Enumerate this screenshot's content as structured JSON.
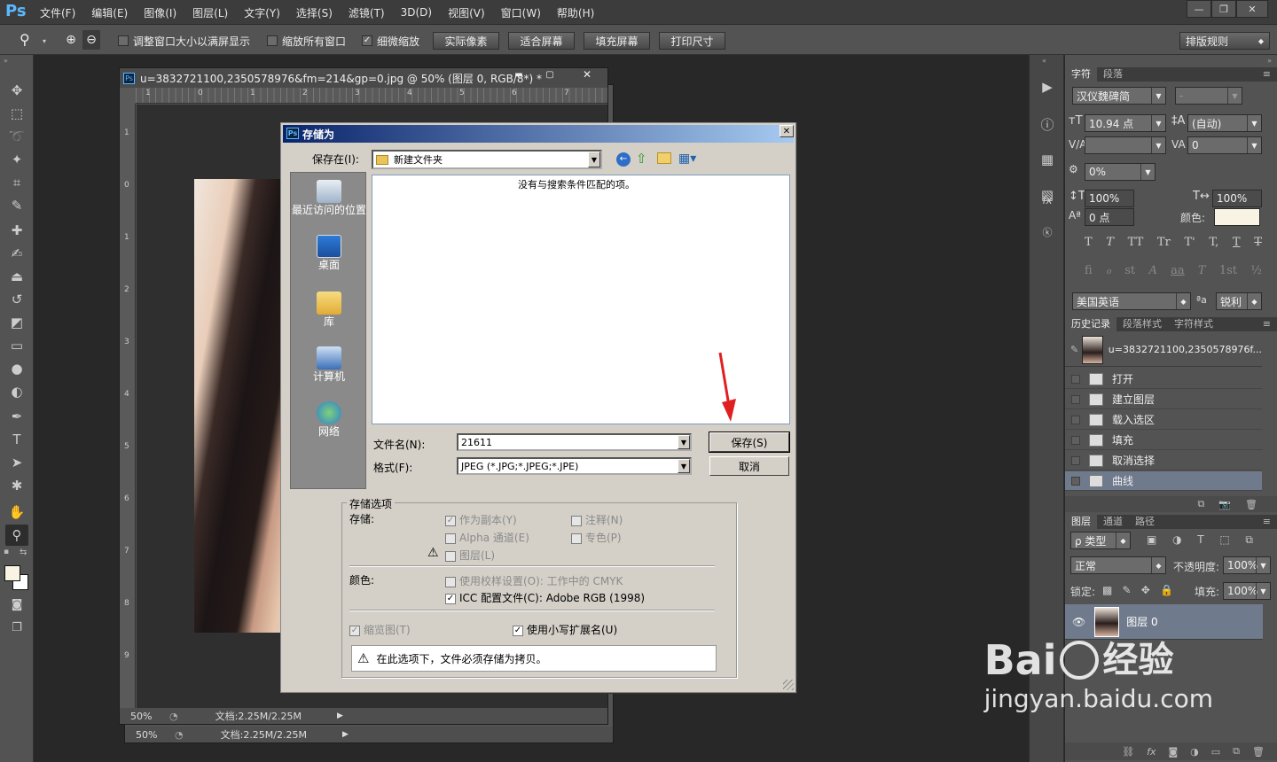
{
  "menubar": {
    "logo": "Ps",
    "items": [
      "文件(F)",
      "编辑(E)",
      "图像(I)",
      "图层(L)",
      "文字(Y)",
      "选择(S)",
      "滤镜(T)",
      "3D(D)",
      "视图(V)",
      "窗口(W)",
      "帮助(H)"
    ],
    "minimize": "—",
    "restore": "❐",
    "close": "✕"
  },
  "options": {
    "resize_windows": "调整窗口大小以满屏显示",
    "zoom_all": "缩放所有窗口",
    "scrubby": "细微缩放",
    "actual_pixels": "实际像素",
    "fit_screen": "适合屏幕",
    "fill_screen": "填充屏幕",
    "print_size": "打印尺寸",
    "workspace": "排版规则"
  },
  "document": {
    "title": "u=3832721100,2350578976&fm=214&gp=0.jpg  @  50%  (图层 0, RGB/8*) *",
    "ruler_top": [
      "1",
      "0",
      "1",
      "2",
      "3",
      "4",
      "5",
      "6",
      "7"
    ],
    "ruler_left": [
      "1",
      "0",
      "1",
      "2",
      "3",
      "4",
      "5",
      "6",
      "7",
      "8",
      "9"
    ],
    "zoom": "50%",
    "doc_size": "文档:2.25M/2.25M",
    "zoom_back": "50%",
    "doc_size_back": "文档:2.25M/2.25M"
  },
  "dialog": {
    "title": "存储为",
    "save_in_label": "保存在(I):",
    "save_in_value": "新建文件夹",
    "empty_message": "没有与搜索条件匹配的项。",
    "places": [
      "最近访问的位置",
      "桌面",
      "库",
      "计算机",
      "网络"
    ],
    "filename_label": "文件名(N):",
    "filename_value": "21611",
    "format_label": "格式(F):",
    "format_value": "JPEG (*.JPG;*.JPEG;*.JPE)",
    "save_button": "保存(S)",
    "cancel_button": "取消",
    "options_group": "存储选项",
    "store_label": "存储:",
    "as_copy": "作为副本(Y)",
    "notes": "注释(N)",
    "alpha": "Alpha 通道(E)",
    "spot": "专色(P)",
    "layers": "图层(L)",
    "color_label": "颜色:",
    "proof": "使用校样设置(O): 工作中的 CMYK",
    "icc": "ICC 配置文件(C):  Adobe RGB (1998)",
    "thumbnail": "缩览图(T)",
    "lowercase_ext": "使用小写扩展名(U)",
    "warning": "在此选项下，文件必须存储为拷贝。"
  },
  "character_panel": {
    "tabs": [
      "字符",
      "段落"
    ],
    "font_family": "汉仪魏碑简",
    "font_style": "-",
    "font_size": "10.94 点",
    "leading": "(自动)",
    "kerning": "",
    "tracking": "0",
    "scale_tsume": "0%",
    "vertical_scale": "100%",
    "horizontal_scale": "100%",
    "baseline_shift": "0 点",
    "color_label": "颜色:",
    "text_color": "#f8f3e3",
    "language": "美国英语",
    "aa_icon": "ªa",
    "antialias": "锐利",
    "style_buttons": [
      "T",
      "T",
      "TT",
      "Tr",
      "T'",
      "T,",
      "T",
      "T"
    ],
    "opentype_buttons": [
      "fi",
      "ℴ",
      "st",
      "A",
      "aa",
      "T",
      "1st",
      "½"
    ]
  },
  "history_panel": {
    "tabs": [
      "历史记录",
      "段落样式",
      "字符样式"
    ],
    "snapshot": "u=3832721100,2350578976f...",
    "items": [
      "打开",
      "建立图层",
      "载入选区",
      "填充",
      "取消选择",
      "曲线"
    ]
  },
  "layers_panel": {
    "tabs": [
      "图层",
      "通道",
      "路径"
    ],
    "filter_type": "ρ 类型",
    "blend_mode": "正常",
    "opacity_label": "不透明度:",
    "opacity": "100%",
    "lock_label": "锁定:",
    "fill_label": "填充:",
    "fill": "100%",
    "layer_name": "图层 0"
  },
  "watermark": {
    "logo": "Bai",
    "logo_tail": "经验",
    "url": "jingyan.baidu.com"
  }
}
